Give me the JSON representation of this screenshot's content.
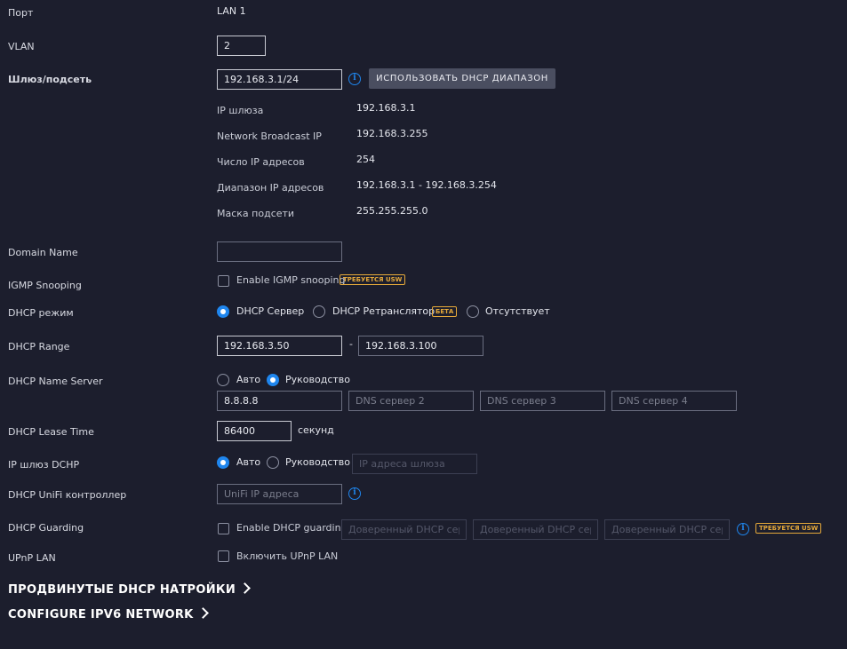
{
  "port": {
    "label": "Порт",
    "value": "LAN 1"
  },
  "vlan": {
    "label": "VLAN",
    "value": "2"
  },
  "gateway": {
    "label": "Шлюз/подсеть",
    "value": "192.168.3.1/24",
    "dhcp_range_button": "ИСПОЛЬЗОВАТЬ DHCP ДИАПАЗОН",
    "details": [
      {
        "label": "IP шлюза",
        "value": "192.168.3.1"
      },
      {
        "label": "Network Broadcast IP",
        "value": "192.168.3.255"
      },
      {
        "label": "Число IP адресов",
        "value": "254"
      },
      {
        "label": "Диапазон IP адресов",
        "value": "192.168.3.1 - 192.168.3.254"
      },
      {
        "label": "Маска подсети",
        "value": "255.255.255.0"
      }
    ]
  },
  "domain_name": {
    "label": "Domain Name",
    "value": ""
  },
  "igmp": {
    "label": "IGMP Snooping",
    "checkbox_label": "Enable IGMP snooping",
    "checked": false,
    "badge": "ТРЕБУЕТСЯ USW"
  },
  "dhcp_mode": {
    "label": "DHCP режим",
    "options": [
      "DHCP Сервер",
      "DHCP Ретранслятор",
      "Отсутствует"
    ],
    "selected": "DHCP Сервер",
    "beta_badge": "БЕТА"
  },
  "dhcp_range": {
    "label": "DHCP Range",
    "start": "192.168.3.50",
    "separator": "-",
    "end": "192.168.3.100"
  },
  "dhcp_name_server": {
    "label": "DHCP Name Server",
    "options": [
      "Авто",
      "Руководство"
    ],
    "selected": "Руководство",
    "dns1": "8.8.8.8",
    "dns2_placeholder": "DNS сервер 2",
    "dns3_placeholder": "DNS сервер 3",
    "dns4_placeholder": "DNS сервер 4"
  },
  "lease_time": {
    "label": "DHCP Lease Time",
    "value": "86400",
    "unit": "секунд"
  },
  "dhcp_gateway": {
    "label": "IP шлюз DCHP",
    "options": [
      "Авто",
      "Руководство"
    ],
    "selected": "Авто",
    "placeholder": "IP адреса шлюза"
  },
  "unifi_controller": {
    "label": "DHCP UniFi контроллер",
    "placeholder": "UniFi IP адреса"
  },
  "dhcp_guarding": {
    "label": "DHCP Guarding",
    "checkbox_label": "Enable DHCP guarding",
    "checked": false,
    "placeholder": "Доверенный DHCP сервер",
    "badge": "ТРЕБУЕТСЯ USW"
  },
  "upnp": {
    "label": "UPnP LAN",
    "checkbox_label": "Включить UPnP LAN",
    "checked": false
  },
  "sections": {
    "advanced_dhcp": "ПРОДВИНУТЫЕ DHCP НАТРОЙКИ",
    "ipv6": "CONFIGURE IPV6 NETWORK"
  },
  "icons": {
    "info": "info-icon",
    "chevron": "chevron-right-icon",
    "info_glyph": "i"
  },
  "colors": {
    "background": "#1c1e2d",
    "accent": "#1f86ee",
    "badge": "#e5a93a",
    "button": "#4a4e60"
  }
}
